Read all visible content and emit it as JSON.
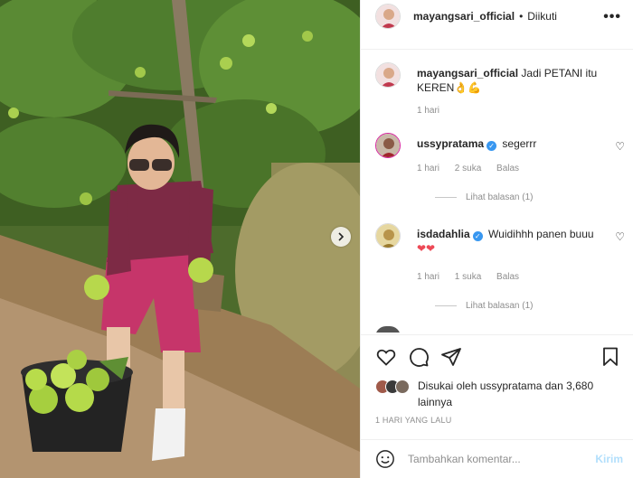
{
  "post": {
    "username": "mayangsari_official",
    "follow_status": "Diikuti",
    "separator": "•",
    "more_icon": "more-horizontal-icon"
  },
  "caption": {
    "username": "mayangsari_official",
    "text": "Jadi PETANI itu KEREN👌💪",
    "age": "1 hari"
  },
  "comments": [
    {
      "username": "ussypratama",
      "verified": true,
      "text": "segerrr",
      "age": "1 hari",
      "likes": "2 suka",
      "reply": "Balas",
      "view_replies": "Lihat balasan (1)"
    },
    {
      "username": "isdadahlia",
      "verified": true,
      "text": "Wuidihhh panen buuu",
      "hearts": "❤❤",
      "age": "1 hari",
      "likes": "1 suka",
      "reply": "Balas",
      "view_replies": "Lihat balasan (1)"
    }
  ],
  "likes": {
    "text": "Disukai oleh ussypratama dan 3,680 lainnya"
  },
  "timestamp": "1 HARI YANG LALU",
  "composer": {
    "placeholder": "Tambahkan komentar...",
    "send_label": "Kirim"
  },
  "colors": {
    "verified": "#3897f0",
    "heart": "#ed4956",
    "send_disabled": "#b2dffc",
    "muted": "#8e8e8e"
  }
}
